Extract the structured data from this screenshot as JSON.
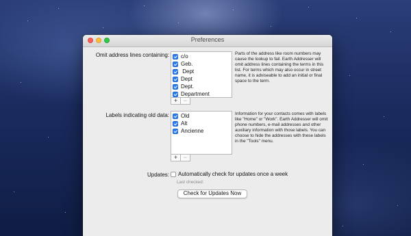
{
  "window": {
    "title": "Preferences"
  },
  "omit_section": {
    "label": "Omit address lines containing:",
    "items": [
      {
        "text": "c/o",
        "checked": true
      },
      {
        "text": "Geb.",
        "checked": true
      },
      {
        "text": " Dept",
        "checked": true
      },
      {
        "text": "Dept",
        "checked": true
      },
      {
        "text": "Dept.",
        "checked": true
      },
      {
        "text": "Department",
        "checked": true
      }
    ],
    "help": "Parts of the address like room numbers may cause the lookup to fail. Earth Addresser will omit address lines containing the terms in this list. For terms which may also occur in street name, it is adviseable to add an initial or final space to the term."
  },
  "labels_section": {
    "label": "Labels indicating old data:",
    "items": [
      {
        "text": "Old",
        "checked": true
      },
      {
        "text": "Alt",
        "checked": true
      },
      {
        "text": "Ancienne",
        "checked": true
      }
    ],
    "help": "Information for your contacts comes with labels like \"Home\" or \"Work\". Earth Addresser will omit phone numbers, e-mail addresses and other auxiliary information with those labels. You can choose to hide the addresses with these labels in the \"Tools\" menu."
  },
  "list_controls": {
    "add": "+",
    "remove": "−"
  },
  "updates": {
    "label": "Updates:",
    "checkbox_label": "Automatically check for updates once a week",
    "checked": false,
    "last_checked": "Last checked:",
    "button": "Check for Updates Now"
  }
}
